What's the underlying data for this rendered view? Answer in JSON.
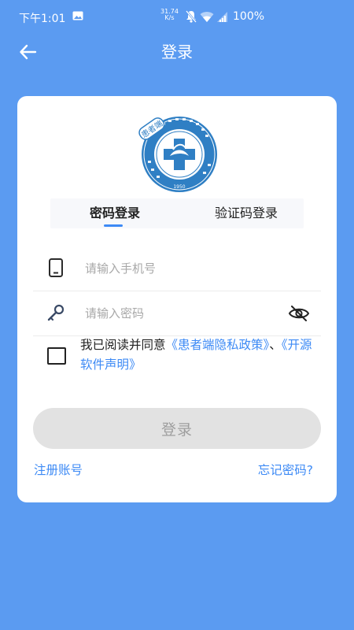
{
  "status_bar": {
    "time": "下午1:01",
    "net_speed_value": "31.74",
    "net_speed_unit": "K/s",
    "battery": "100%"
  },
  "header": {
    "title": "登录",
    "back_icon": "arrow-left-icon"
  },
  "logo": {
    "name": "hospital-logo",
    "badge_text": "患者端",
    "year": "1950"
  },
  "tabs": [
    {
      "label": "密码登录",
      "active": true
    },
    {
      "label": "验证码登录",
      "active": false
    }
  ],
  "form": {
    "phone_placeholder": "请输入手机号",
    "phone_value": "",
    "password_placeholder": "请输入密码",
    "password_value": "",
    "phone_icon": "phone-icon",
    "password_icon": "key-icon",
    "visibility_icon": "eye-off-icon"
  },
  "agreement": {
    "checked": false,
    "prefix": "我已阅读并同意",
    "privacy_link": "《患者端隐私政策》",
    "separator": "、",
    "opensource_link": "《开源软件声明》"
  },
  "login_button_label": "登录",
  "register_link": "注册账号",
  "forgot_link": "忘记密码?",
  "colors": {
    "background": "#5b9bf1",
    "accent": "#3d8af5",
    "button_disabled": "#e2e2e2"
  }
}
